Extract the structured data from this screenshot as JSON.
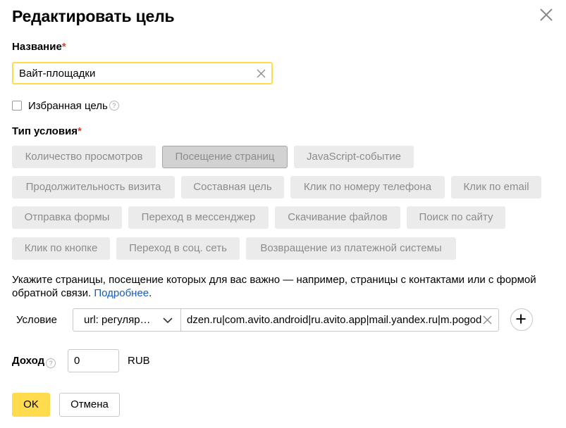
{
  "dialog": {
    "title": "Редактировать цель"
  },
  "name_field": {
    "label": "Название",
    "required_mark": "*",
    "value": "Вайт-площадки"
  },
  "favorite": {
    "label": "Избранная цель",
    "help": "?",
    "checked": false
  },
  "condition_type": {
    "label": "Тип условия",
    "required_mark": "*",
    "options": [
      {
        "label": "Количество просмотров",
        "active": false
      },
      {
        "label": "Посещение страниц",
        "active": true
      },
      {
        "label": "JavaScript-событие",
        "active": false
      },
      {
        "label": "Продолжительность визита",
        "active": false
      },
      {
        "label": "Составная цель",
        "active": false
      },
      {
        "label": "Клик по номеру телефона",
        "active": false
      },
      {
        "label": "Клик по email",
        "active": false
      },
      {
        "label": "Отправка формы",
        "active": false
      },
      {
        "label": "Переход в мессенджер",
        "active": false
      },
      {
        "label": "Скачивание файлов",
        "active": false
      },
      {
        "label": "Поиск по сайту",
        "active": false
      },
      {
        "label": "Клик по кнопке",
        "active": false
      },
      {
        "label": "Переход в соц. сеть",
        "active": false
      },
      {
        "label": "Возвращение из платежной системы",
        "active": false
      }
    ]
  },
  "description": {
    "text": "Укажите страницы, посещение которых для вас важно — например, страницы с контактами или с формой обратной связи. ",
    "link": "Подробнее",
    "end": "."
  },
  "condition": {
    "label": "Условие",
    "match_type": "url: регуляр…",
    "value": "dzen.ru|com.avito.android|ru.avito.app|mail.yandex.ru|m.pogoda.yandex.ru"
  },
  "income": {
    "label": "Доход",
    "help": "?",
    "value": "0",
    "currency": "RUB"
  },
  "buttons": {
    "ok": "OK",
    "cancel": "Отмена"
  },
  "colors": {
    "accent": "#ffdb4d",
    "link": "#1a5cb8",
    "required": "#e5392b"
  }
}
